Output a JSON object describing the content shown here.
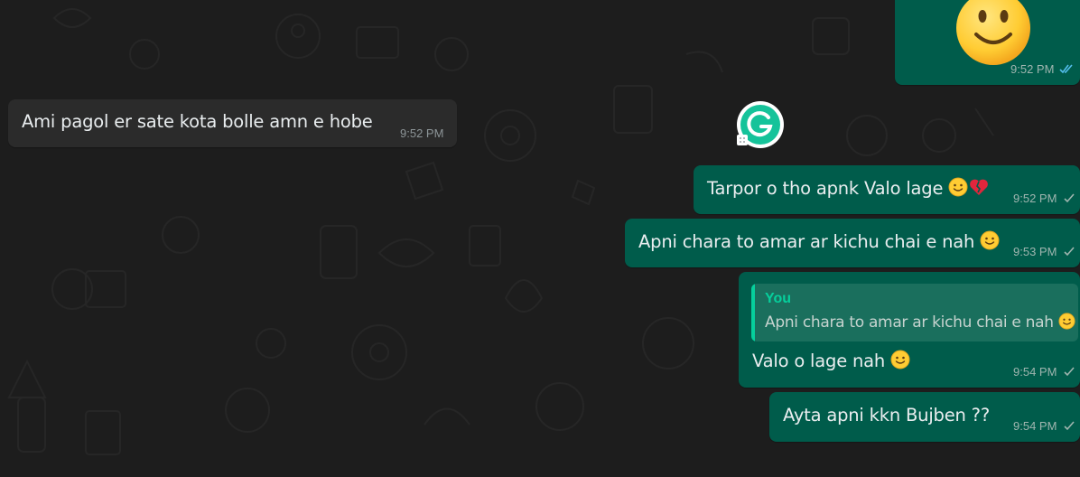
{
  "messages": [
    {
      "id": "m0",
      "direction": "outgoing",
      "content": "smiley-emoji",
      "time": "9:52 PM",
      "status": "read"
    },
    {
      "id": "m1",
      "direction": "incoming",
      "text": "Ami pagol er sate kota bolle amn e hobe",
      "time": "9:52 PM"
    },
    {
      "id": "m2",
      "direction": "outgoing",
      "text": "Tarpor o tho apnk Valo lage",
      "emojis": [
        "smiling-face-emoji",
        "broken-heart-emoji"
      ],
      "time": "9:52 PM",
      "status": "sent"
    },
    {
      "id": "m3",
      "direction": "outgoing",
      "text": "Apni chara to amar ar kichu chai e nah",
      "emojis": [
        "smiling-face-emoji"
      ],
      "time": "9:53 PM",
      "status": "sent"
    },
    {
      "id": "m4",
      "direction": "outgoing",
      "quote": {
        "author": "You",
        "text": "Apni chara to amar ar kichu chai e nah"
      },
      "text": "Valo o lage nah",
      "emojis": [
        "smiling-face-emoji"
      ],
      "time": "9:54 PM",
      "status": "sent"
    },
    {
      "id": "m5",
      "direction": "outgoing",
      "text": "Ayta apni kkn  Bujben ??",
      "time": "9:54 PM",
      "status": "sent"
    }
  ],
  "overlay": {
    "icon": "grammarly-icon",
    "letter": "G"
  },
  "colors": {
    "background": "#1d1d1d",
    "incoming_bubble": "#2b2b2b",
    "outgoing_bubble": "#005c4b",
    "quote_accent": "#06cf9c",
    "read_tick": "#53bdeb",
    "grammarly_green": "#15c39a"
  }
}
